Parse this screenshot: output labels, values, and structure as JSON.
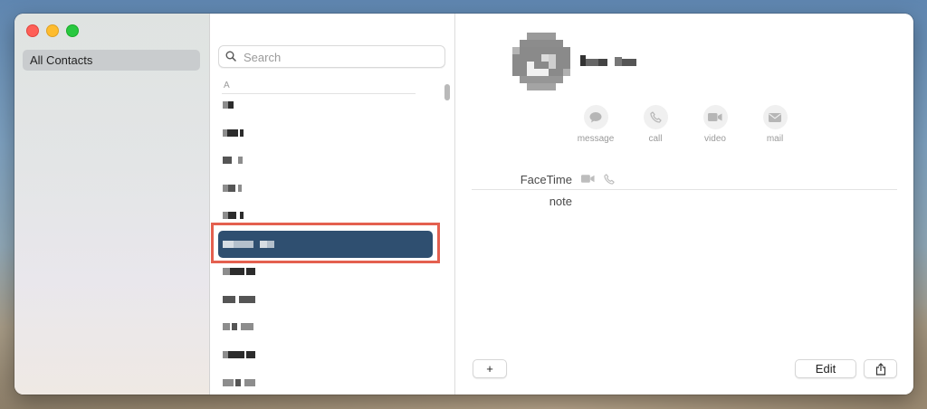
{
  "sidebar": {
    "items": [
      {
        "label": "All Contacts"
      }
    ]
  },
  "list": {
    "search_placeholder": "Search",
    "section_letter": "A",
    "rows": 11,
    "selected_index": 5
  },
  "detail": {
    "actions": [
      {
        "label": "message",
        "icon": "message-bubble-icon"
      },
      {
        "label": "call",
        "icon": "phone-icon"
      },
      {
        "label": "video",
        "icon": "video-camera-icon"
      },
      {
        "label": "mail",
        "icon": "envelope-icon"
      }
    ],
    "fields": {
      "facetime_label": "FaceTime",
      "note_label": "note"
    }
  },
  "bottom_bar": {
    "add_label": "+",
    "edit_label": "Edit",
    "share_icon": "share-icon"
  },
  "colors": {
    "selection": "#2f4f70",
    "highlight_frame": "#e4604f"
  }
}
